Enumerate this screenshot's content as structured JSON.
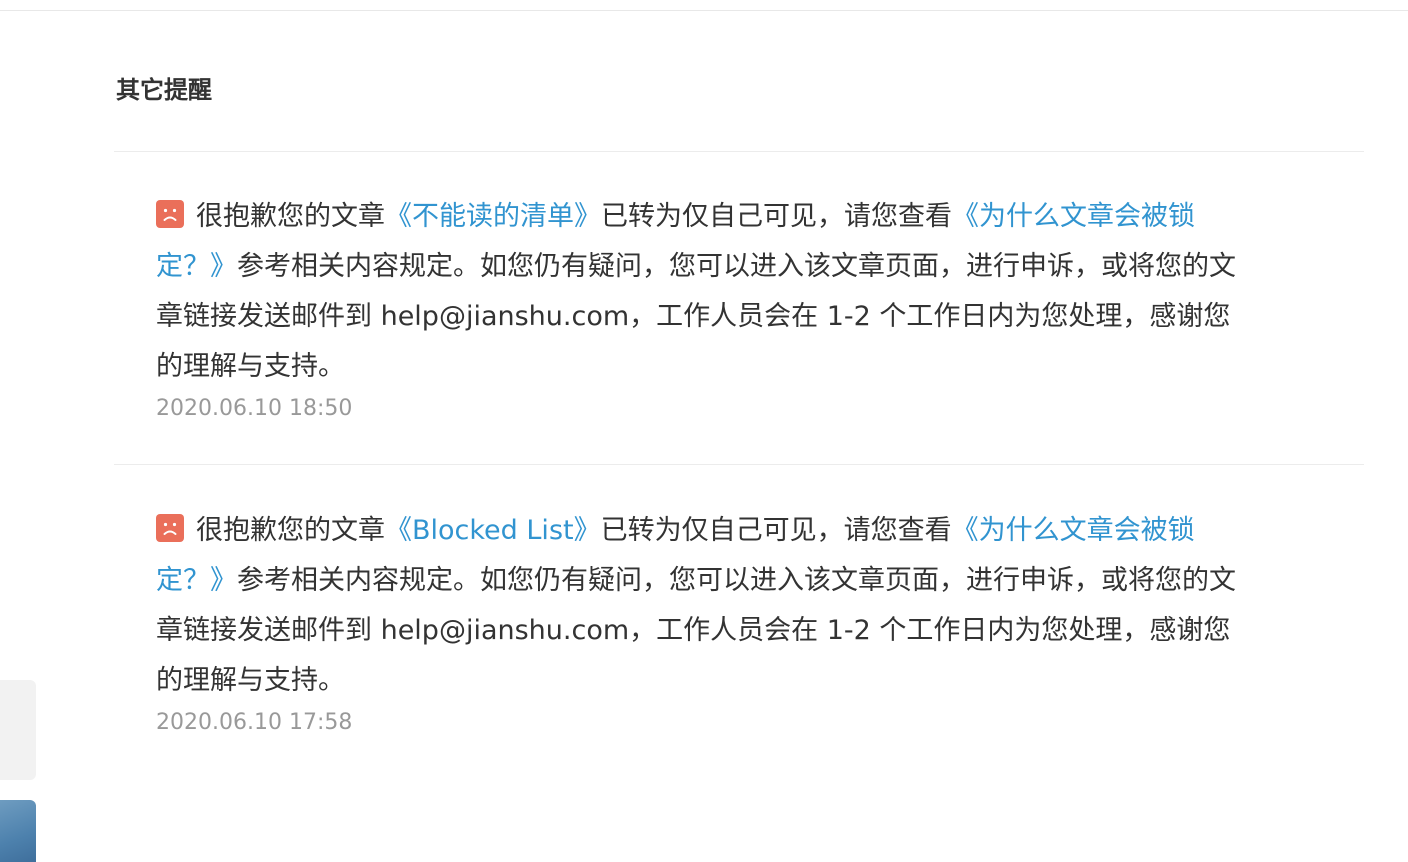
{
  "section": {
    "title": "其它提醒"
  },
  "notices": [
    {
      "prefix": "很抱歉您的文章",
      "article_link": "《不能读的清单》",
      "middle": "已转为仅自己可见，请您查看",
      "policy_link": "《为什么文章会被锁定？》",
      "suffix": "参考相关内容规定。如您仍有疑问，您可以进入该文章页面，进行申诉，或将您的文章链接发送邮件到 help@jianshu.com，工作人员会在 1-2 个工作日内为您处理，感谢您的理解与支持。",
      "timestamp": "2020.06.10 18:50",
      "icon": "sad-face-icon"
    },
    {
      "prefix": "很抱歉您的文章",
      "article_link": "《Blocked List》",
      "middle": "已转为仅自己可见，请您查看",
      "policy_link": "《为什么文章会被锁定？》",
      "suffix": "参考相关内容规定。如您仍有疑问，您可以进入该文章页面，进行申诉，或将您的文章链接发送邮件到 help@jianshu.com，工作人员会在 1-2 个工作日内为您处理，感谢您的理解与支持。",
      "timestamp": "2020.06.10 17:58",
      "icon": "sad-face-icon"
    }
  ],
  "colors": {
    "link": "#3194d0",
    "icon_bg": "#ea6f5a",
    "text": "#333333",
    "muted": "#999999"
  }
}
